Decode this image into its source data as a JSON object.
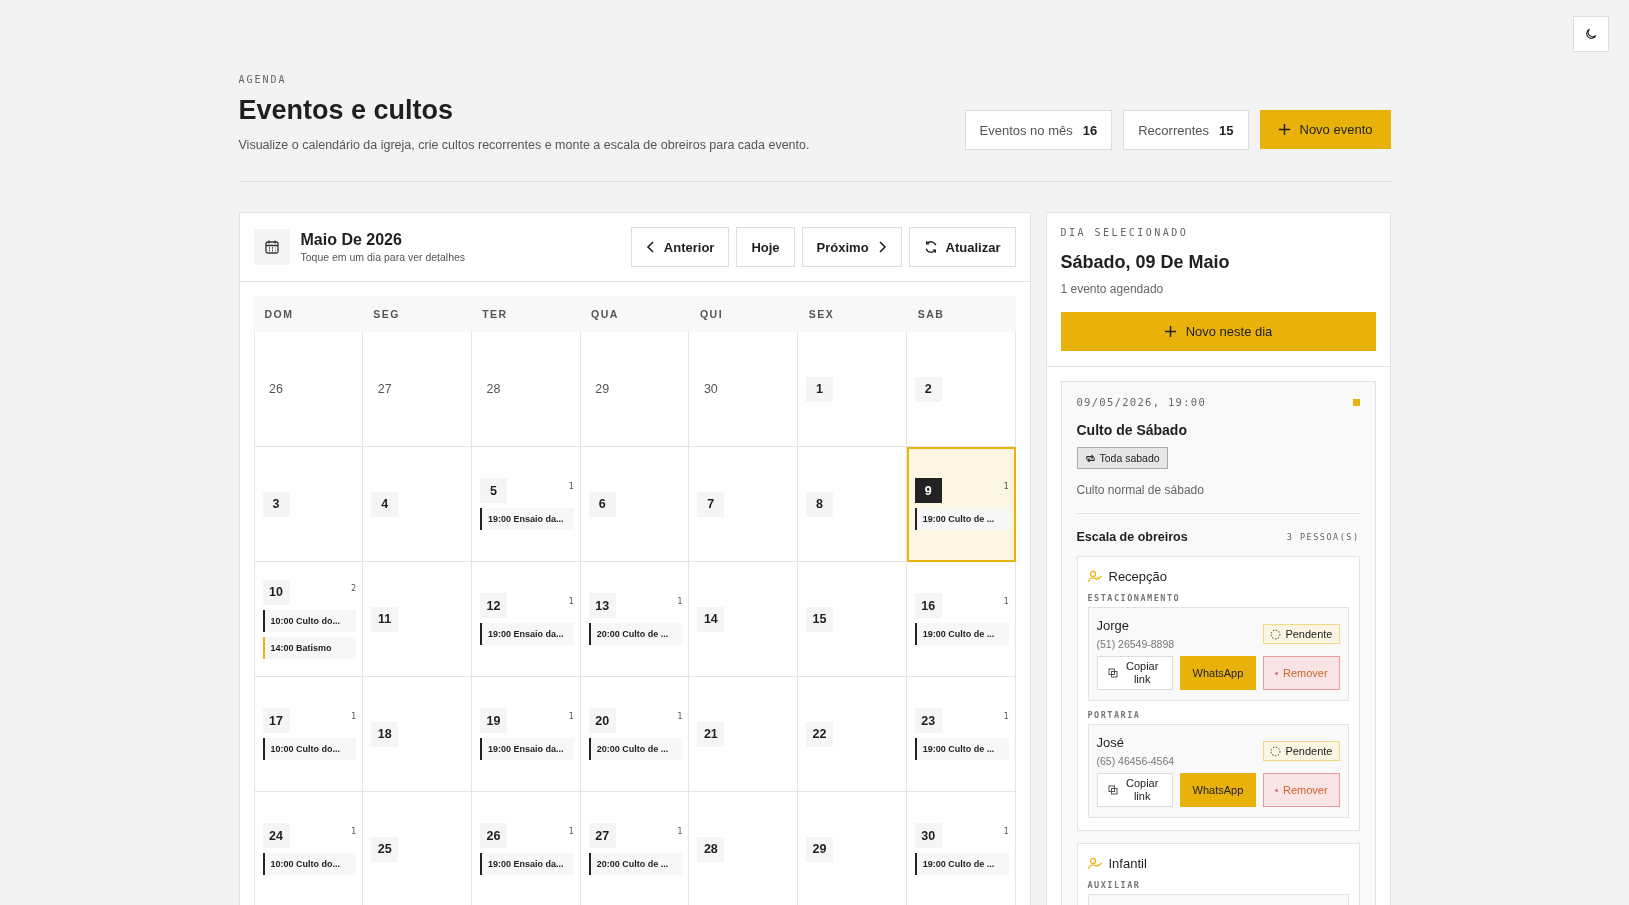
{
  "header": {
    "eyebrow": "AGENDA",
    "title": "Eventos e cultos",
    "subtitle": "Visualize o calendário da igreja, crie cultos recorrentes e monte a escala de obreiros para cada evento."
  },
  "stats": [
    {
      "label": "Eventos no mês",
      "value": "16"
    },
    {
      "label": "Recorrentes",
      "value": "15"
    }
  ],
  "new_event_button": "Novo evento",
  "calendar": {
    "title": "Maio De 2026",
    "subtitle": "Toque em um dia para ver detalhes",
    "buttons": [
      {
        "kind": "prev",
        "label": "Anterior"
      },
      {
        "kind": "plain",
        "label": "Hoje"
      },
      {
        "kind": "next",
        "label": "Próximo"
      },
      {
        "kind": "refresh",
        "label": "Atualizar"
      }
    ],
    "weekdays": [
      "DOM",
      "SEG",
      "TER",
      "QUA",
      "QUI",
      "SEX",
      "SAB"
    ],
    "weeks": [
      [
        {
          "day": "26",
          "muted": true,
          "selected": false
        },
        {
          "day": "27",
          "muted": true,
          "selected": false
        },
        {
          "day": "28",
          "muted": true,
          "selected": false
        },
        {
          "day": "29",
          "muted": true,
          "selected": false
        },
        {
          "day": "30",
          "muted": true,
          "selected": false
        },
        {
          "day": "1",
          "muted": false,
          "selected": false
        },
        {
          "day": "2",
          "muted": false,
          "selected": false
        }
      ],
      [
        {
          "day": "3",
          "muted": false,
          "selected": false
        },
        {
          "day": "4",
          "muted": false,
          "selected": false
        },
        {
          "day": "5",
          "muted": false,
          "selected": false,
          "count": "1",
          "events": [
            {
              "label": "19:00 Ensaio da...",
              "color": "#222222"
            }
          ]
        },
        {
          "day": "6",
          "muted": false,
          "selected": false
        },
        {
          "day": "7",
          "muted": false,
          "selected": false
        },
        {
          "day": "8",
          "muted": false,
          "selected": false
        },
        {
          "day": "9",
          "muted": false,
          "selected": true,
          "count": "1",
          "events": [
            {
              "label": "19:00 Culto de ...",
              "color": "#222222"
            }
          ]
        }
      ],
      [
        {
          "day": "10",
          "muted": false,
          "selected": false,
          "count": "2",
          "events": [
            {
              "label": "10:00 Culto do...",
              "color": "#222222"
            },
            {
              "label": "14:00 Batismo",
              "color": "#e8b20a"
            }
          ]
        },
        {
          "day": "11",
          "muted": false,
          "selected": false
        },
        {
          "day": "12",
          "muted": false,
          "selected": false,
          "count": "1",
          "events": [
            {
              "label": "19:00 Ensaio da...",
              "color": "#222222"
            }
          ]
        },
        {
          "day": "13",
          "muted": false,
          "selected": false,
          "count": "1",
          "events": [
            {
              "label": "20:00 Culto de ...",
              "color": "#222222"
            }
          ]
        },
        {
          "day": "14",
          "muted": false,
          "selected": false
        },
        {
          "day": "15",
          "muted": false,
          "selected": false
        },
        {
          "day": "16",
          "muted": false,
          "selected": false,
          "count": "1",
          "events": [
            {
              "label": "19:00 Culto de ...",
              "color": "#222222"
            }
          ]
        }
      ],
      [
        {
          "day": "17",
          "muted": false,
          "selected": false,
          "count": "1",
          "events": [
            {
              "label": "10:00 Culto do...",
              "color": "#222222"
            }
          ]
        },
        {
          "day": "18",
          "muted": false,
          "selected": false
        },
        {
          "day": "19",
          "muted": false,
          "selected": false,
          "count": "1",
          "events": [
            {
              "label": "19:00 Ensaio da...",
              "color": "#222222"
            }
          ]
        },
        {
          "day": "20",
          "muted": false,
          "selected": false,
          "count": "1",
          "events": [
            {
              "label": "20:00 Culto de ...",
              "color": "#222222"
            }
          ]
        },
        {
          "day": "21",
          "muted": false,
          "selected": false
        },
        {
          "day": "22",
          "muted": false,
          "selected": false
        },
        {
          "day": "23",
          "muted": false,
          "selected": false,
          "count": "1",
          "events": [
            {
              "label": "19:00 Culto de ...",
              "color": "#222222"
            }
          ]
        }
      ],
      [
        {
          "day": "24",
          "muted": false,
          "selected": false,
          "count": "1",
          "events": [
            {
              "label": "10:00 Culto do...",
              "color": "#222222"
            }
          ]
        },
        {
          "day": "25",
          "muted": false,
          "selected": false
        },
        {
          "day": "26",
          "muted": false,
          "selected": false,
          "count": "1",
          "events": [
            {
              "label": "19:00 Ensaio da...",
              "color": "#222222"
            }
          ]
        },
        {
          "day": "27",
          "muted": false,
          "selected": false,
          "count": "1",
          "events": [
            {
              "label": "20:00 Culto de ...",
              "color": "#222222"
            }
          ]
        },
        {
          "day": "28",
          "muted": false,
          "selected": false
        },
        {
          "day": "29",
          "muted": false,
          "selected": false
        },
        {
          "day": "30",
          "muted": false,
          "selected": false,
          "count": "1",
          "events": [
            {
              "label": "19:00 Culto de ...",
              "color": "#222222"
            }
          ]
        }
      ]
    ]
  },
  "day_panel": {
    "eyebrow": "DIA SELECIONADO",
    "title": "Sábado, 09 De Maio",
    "count": "1 evento agendado",
    "new_button": "Novo neste dia",
    "event": {
      "datetime": "09/05/2026, 19:00",
      "color": "#e8b20a",
      "title": "Culto de Sábado",
      "recurrence": "Toda sabado",
      "description": "Culto normal de sábado",
      "roster_title": "Escala de obreiros",
      "roster_count": "3 PESSOA(S)",
      "groups": [
        {
          "name": "Recepção",
          "positions": [
            {
              "label": "ESTACIONAMENTO",
              "people": [
                {
                  "name": "Jorge",
                  "phone": "(51) 26549-8898",
                  "status": "Pendente",
                  "copy": "Copiar link",
                  "whatsapp": "WhatsApp",
                  "remove": "Remover"
                }
              ]
            },
            {
              "label": "PORTARIA",
              "people": [
                {
                  "name": "José",
                  "phone": "(65) 46456-4564",
                  "status": "Pendente",
                  "copy": "Copiar link",
                  "whatsapp": "WhatsApp",
                  "remove": "Remover"
                }
              ]
            }
          ]
        },
        {
          "name": "Infantil",
          "positions": [
            {
              "label": "AUXILIAR",
              "cut_off": true
            }
          ]
        }
      ]
    }
  }
}
